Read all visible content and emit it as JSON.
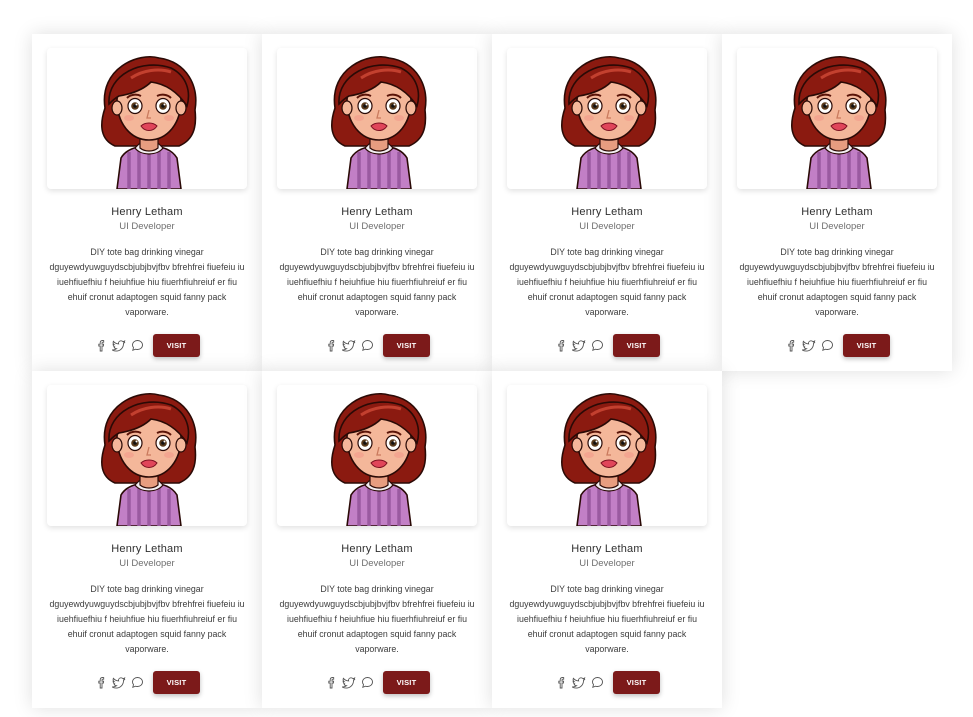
{
  "colors": {
    "visit_button": "#7c1a1a",
    "hair": "#8b1a10",
    "shirt": "#c27fc6",
    "skin": "#f4b79a"
  },
  "cards": [
    {
      "name": "Henry Letham",
      "role": "UI Developer",
      "bio": "DIY tote bag drinking vinegar dguyewdyuwguydscbjubjbvjfbv bfrehfrei fiuefeiu iu iuehfiuefhiu f heiuhfiue hiu fiuerhfiuhreiuf er fiu ehuif cronut adaptogen squid fanny pack vaporware.",
      "visit_label": "VISIT",
      "social_icons": [
        "facebook-icon",
        "twitter-icon",
        "message-icon"
      ]
    },
    {
      "name": "Henry Letham",
      "role": "UI Developer",
      "bio": "DIY tote bag drinking vinegar dguyewdyuwguydscbjubjbvjfbv bfrehfrei fiuefeiu iu iuehfiuefhiu f heiuhfiue hiu fiuerhfiuhreiuf er fiu ehuif cronut adaptogen squid fanny pack vaporware.",
      "visit_label": "VISIT",
      "social_icons": [
        "facebook-icon",
        "twitter-icon",
        "message-icon"
      ]
    },
    {
      "name": "Henry Letham",
      "role": "UI Developer",
      "bio": "DIY tote bag drinking vinegar dguyewdyuwguydscbjubjbvjfbv bfrehfrei fiuefeiu iu iuehfiuefhiu f heiuhfiue hiu fiuerhfiuhreiuf er fiu ehuif cronut adaptogen squid fanny pack vaporware.",
      "visit_label": "VISIT",
      "social_icons": [
        "facebook-icon",
        "twitter-icon",
        "message-icon"
      ]
    },
    {
      "name": "Henry Letham",
      "role": "UI Developer",
      "bio": "DIY tote bag drinking vinegar dguyewdyuwguydscbjubjbvjfbv bfrehfrei fiuefeiu iu iuehfiuefhiu f heiuhfiue hiu fiuerhfiuhreiuf er fiu ehuif cronut adaptogen squid fanny pack vaporware.",
      "visit_label": "VISIT",
      "social_icons": [
        "facebook-icon",
        "twitter-icon",
        "message-icon"
      ]
    },
    {
      "name": "Henry Letham",
      "role": "UI Developer",
      "bio": "DIY tote bag drinking vinegar dguyewdyuwguydscbjubjbvjfbv bfrehfrei fiuefeiu iu iuehfiuefhiu f heiuhfiue hiu fiuerhfiuhreiuf er fiu ehuif cronut adaptogen squid fanny pack vaporware.",
      "visit_label": "VISIT",
      "social_icons": [
        "facebook-icon",
        "twitter-icon",
        "message-icon"
      ]
    },
    {
      "name": "Henry Letham",
      "role": "UI Developer",
      "bio": "DIY tote bag drinking vinegar dguyewdyuwguydscbjubjbvjfbv bfrehfrei fiuefeiu iu iuehfiuefhiu f heiuhfiue hiu fiuerhfiuhreiuf er fiu ehuif cronut adaptogen squid fanny pack vaporware.",
      "visit_label": "VISIT",
      "social_icons": [
        "facebook-icon",
        "twitter-icon",
        "message-icon"
      ]
    },
    {
      "name": "Henry Letham",
      "role": "UI Developer",
      "bio": "DIY tote bag drinking vinegar dguyewdyuwguydscbjubjbvjfbv bfrehfrei fiuefeiu iu iuehfiuefhiu f heiuhfiue hiu fiuerhfiuhreiuf er fiu ehuif cronut adaptogen squid fanny pack vaporware.",
      "visit_label": "VISIT",
      "social_icons": [
        "facebook-icon",
        "twitter-icon",
        "message-icon"
      ]
    }
  ]
}
